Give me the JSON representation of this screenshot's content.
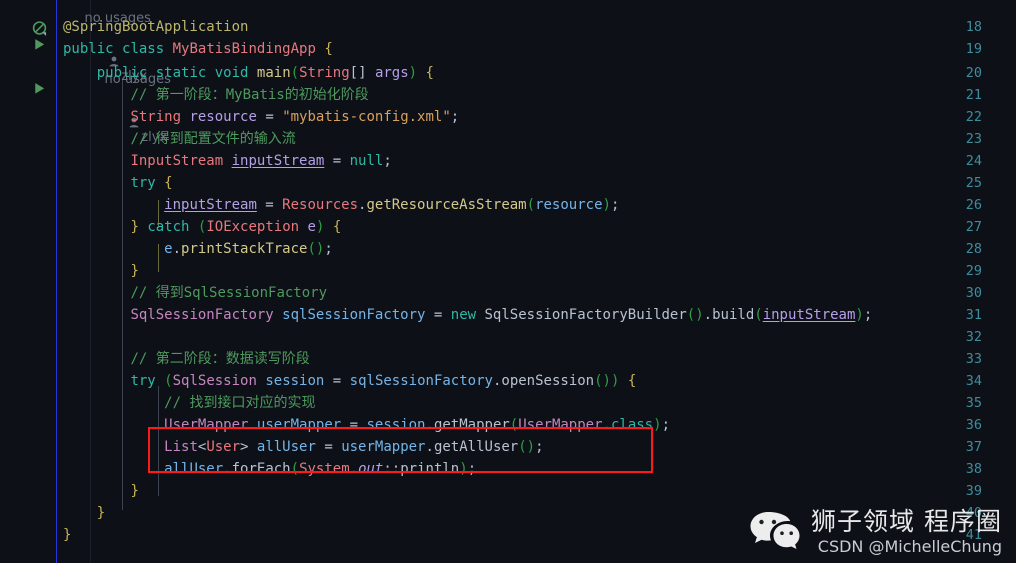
{
  "editor": {
    "background": "#0d1017",
    "gutter_marker_color": "#2736d8",
    "line_number_color": "#3f8d9b",
    "top_partial_hint": {
      "text": "no usages",
      "author": "zlyx",
      "person_icon": "person-icon"
    },
    "inlay_hint": {
      "text": "no usages",
      "author": "zlyx",
      "person_icon": "person-icon"
    },
    "gutter_icons": [
      {
        "line": 18,
        "icon": "spring-bean-icon",
        "color": "#4e9a5e"
      },
      {
        "line": 19,
        "icon": "run-icon",
        "color": "#4e9a5e"
      },
      {
        "line": 20,
        "icon": "run-icon",
        "color": "#4e9a5e"
      }
    ],
    "highlight_box": {
      "color": "#ff1a1a",
      "lines": [
        36,
        37
      ]
    },
    "line_numbers": [
      18,
      19,
      20,
      21,
      22,
      23,
      24,
      25,
      26,
      27,
      28,
      29,
      30,
      31,
      32,
      33,
      34,
      35,
      36,
      37,
      38,
      39,
      40,
      41
    ],
    "lines": {
      "18": "@SpringBootApplication",
      "19": "public class MyBatisBindingApp {",
      "20": "    public static void main(String[] args) {",
      "21": "        // 第一阶段：MyBatis的初始化阶段",
      "22": "        String resource = \"mybatis-config.xml\";",
      "23": "        // 得到配置文件的输入流",
      "24": "        InputStream inputStream = null;",
      "25": "        try {",
      "26": "            inputStream = Resources.getResourceAsStream(resource);",
      "27": "        } catch (IOException e) {",
      "28": "            e.printStackTrace();",
      "29": "        }",
      "30": "        // 得到SqlSessionFactory",
      "31": "        SqlSessionFactory sqlSessionFactory = new SqlSessionFactoryBuilder().build(inputStream);",
      "32": "",
      "33": "        // 第二阶段：数据读写阶段",
      "34": "        try (SqlSession session = sqlSessionFactory.openSession()) {",
      "35": "            // 找到接口对应的实现",
      "36": "            UserMapper userMapper = session.getMapper(UserMapper.class);",
      "37": "            List<User> allUser = userMapper.getAllUser();",
      "38": "            allUser.forEach(System.out::println);",
      "39": "        }",
      "40": "    }",
      "41": "}"
    },
    "tokens": {
      "l18": [
        [
          "@SpringBootApplication",
          "anno"
        ]
      ],
      "l19": [
        [
          "public",
          "kw"
        ],
        [
          " ",
          "punc"
        ],
        [
          "class",
          "kw"
        ],
        [
          " ",
          "punc"
        ],
        [
          "MyBatisBindingApp",
          "cls"
        ],
        [
          " ",
          "punc"
        ],
        [
          "{",
          "brace"
        ]
      ],
      "l20": [
        [
          "    ",
          "punc"
        ],
        [
          "public",
          "kw"
        ],
        [
          " ",
          "punc"
        ],
        [
          "static",
          "kw"
        ],
        [
          " ",
          "punc"
        ],
        [
          "void",
          "kw"
        ],
        [
          " ",
          "punc"
        ],
        [
          "main",
          "mth"
        ],
        [
          "(",
          "paren"
        ],
        [
          "String",
          "cls"
        ],
        [
          "[] ",
          "punc"
        ],
        [
          "args",
          "field"
        ],
        [
          ")",
          "paren"
        ],
        [
          " ",
          "punc"
        ],
        [
          "{",
          "brace"
        ]
      ],
      "l21": [
        [
          "        ",
          "punc"
        ],
        [
          "// 第一阶段：MyBatis的初始化阶段",
          "cmt"
        ]
      ],
      "l22": [
        [
          "        ",
          "punc"
        ],
        [
          "String",
          "cls"
        ],
        [
          " ",
          "punc"
        ],
        [
          "resource",
          "field"
        ],
        [
          " = ",
          "punc"
        ],
        [
          "\"mybatis-config.xml\"",
          "str"
        ],
        [
          ";",
          "punc"
        ]
      ],
      "l23": [
        [
          "        ",
          "punc"
        ],
        [
          "// 得到配置文件的输入流",
          "cmt"
        ]
      ],
      "l24": [
        [
          "        ",
          "punc"
        ],
        [
          "InputStream",
          "cls"
        ],
        [
          " ",
          "punc"
        ],
        [
          "inputStream",
          "fieldu"
        ],
        [
          " = ",
          "punc"
        ],
        [
          "null",
          "kw"
        ],
        [
          ";",
          "punc"
        ]
      ],
      "l25": [
        [
          "        ",
          "punc"
        ],
        [
          "try",
          "kw"
        ],
        [
          " ",
          "punc"
        ],
        [
          "{",
          "brace"
        ]
      ],
      "l26": [
        [
          "            ",
          "punc"
        ],
        [
          "inputStream",
          "fieldu"
        ],
        [
          " = ",
          "punc"
        ],
        [
          "Resources",
          "cls"
        ],
        [
          ".",
          "punc"
        ],
        [
          "getResourceAsStream",
          "mth"
        ],
        [
          "(",
          "paren"
        ],
        [
          "resource",
          "lvar"
        ],
        [
          ")",
          "paren"
        ],
        [
          ";",
          "punc"
        ]
      ],
      "l27": [
        [
          "        ",
          "punc"
        ],
        [
          "}",
          "brace"
        ],
        [
          " ",
          "punc"
        ],
        [
          "catch",
          "kw"
        ],
        [
          " ",
          "punc"
        ],
        [
          "(",
          "paren"
        ],
        [
          "IOException",
          "cls"
        ],
        [
          " ",
          "punc"
        ],
        [
          "e",
          "field"
        ],
        [
          ")",
          "paren"
        ],
        [
          " ",
          "punc"
        ],
        [
          "{",
          "brace"
        ]
      ],
      "l28": [
        [
          "            ",
          "punc"
        ],
        [
          "e",
          "lvar"
        ],
        [
          ".",
          "punc"
        ],
        [
          "printStackTrace",
          "mth"
        ],
        [
          "(",
          "paren"
        ],
        [
          ")",
          "paren"
        ],
        [
          ";",
          "punc"
        ]
      ],
      "l29": [
        [
          "        ",
          "punc"
        ],
        [
          "}",
          "brace"
        ]
      ],
      "l30": [
        [
          "        ",
          "punc"
        ],
        [
          "// 得到SqlSessionFactory",
          "cmt"
        ]
      ],
      "l31": [
        [
          "        ",
          "punc"
        ],
        [
          "SqlSessionFactory",
          "iface"
        ],
        [
          " ",
          "punc"
        ],
        [
          "sqlSessionFactory",
          "lvar"
        ],
        [
          " = ",
          "punc"
        ],
        [
          "new",
          "kw"
        ],
        [
          " ",
          "punc"
        ],
        [
          "SqlSessionFactoryBuilder",
          "punc"
        ],
        [
          "(",
          "paren"
        ],
        [
          ")",
          "paren"
        ],
        [
          ".",
          "punc"
        ],
        [
          "build",
          "punc"
        ],
        [
          "(",
          "paren"
        ],
        [
          "inputStream",
          "fieldu"
        ],
        [
          ")",
          "paren"
        ],
        [
          ";",
          "punc"
        ]
      ],
      "l32": [],
      "l33": [
        [
          "        ",
          "punc"
        ],
        [
          "// 第二阶段：数据读写阶段",
          "cmt"
        ]
      ],
      "l34": [
        [
          "        ",
          "punc"
        ],
        [
          "try",
          "kw"
        ],
        [
          " ",
          "punc"
        ],
        [
          "(",
          "paren"
        ],
        [
          "SqlSession",
          "iface"
        ],
        [
          " ",
          "punc"
        ],
        [
          "session",
          "lvar"
        ],
        [
          " = ",
          "punc"
        ],
        [
          "sqlSessionFactory",
          "lvar"
        ],
        [
          ".",
          "punc"
        ],
        [
          "openSession",
          "punc"
        ],
        [
          "(",
          "paren"
        ],
        [
          ")",
          "paren"
        ],
        [
          ")",
          "paren"
        ],
        [
          " ",
          "punc"
        ],
        [
          "{",
          "brace"
        ]
      ],
      "l35": [
        [
          "            ",
          "punc"
        ],
        [
          "// 找到接口对应的实现",
          "cmt"
        ]
      ],
      "l36": [
        [
          "            ",
          "punc"
        ],
        [
          "UserMapper",
          "iface"
        ],
        [
          " ",
          "punc"
        ],
        [
          "userMapper",
          "lvar"
        ],
        [
          " = ",
          "punc"
        ],
        [
          "session",
          "lvar"
        ],
        [
          ".",
          "punc"
        ],
        [
          "getMapper",
          "punc"
        ],
        [
          "(",
          "paren"
        ],
        [
          "UserMapper",
          "iface"
        ],
        [
          ".",
          "punc"
        ],
        [
          "class",
          "kw"
        ],
        [
          ")",
          "paren"
        ],
        [
          ";",
          "punc"
        ]
      ],
      "l37": [
        [
          "            ",
          "punc"
        ],
        [
          "List",
          "iface"
        ],
        [
          "<",
          "angle"
        ],
        [
          "User",
          "cls"
        ],
        [
          "> ",
          "angle"
        ],
        [
          "allUser",
          "lvar"
        ],
        [
          " = ",
          "punc"
        ],
        [
          "userMapper",
          "lvar"
        ],
        [
          ".",
          "punc"
        ],
        [
          "getAllUser",
          "punc"
        ],
        [
          "(",
          "paren"
        ],
        [
          ")",
          "paren"
        ],
        [
          ";",
          "punc"
        ]
      ],
      "l38": [
        [
          "            ",
          "punc"
        ],
        [
          "allUser",
          "lvar"
        ],
        [
          ".",
          "punc"
        ],
        [
          "forEach",
          "punc"
        ],
        [
          "(",
          "paren"
        ],
        [
          "System",
          "cls"
        ],
        [
          ".",
          "punc"
        ],
        [
          "out",
          "stat"
        ],
        [
          "::",
          "punc"
        ],
        [
          "println",
          "punc"
        ],
        [
          ")",
          "paren"
        ],
        [
          ";",
          "punc"
        ]
      ],
      "l39": [
        [
          "        ",
          "punc"
        ],
        [
          "}",
          "brace"
        ]
      ],
      "l40": [
        [
          "    ",
          "punc"
        ],
        [
          "}",
          "brace"
        ]
      ],
      "l41": [
        [
          "}",
          "brace"
        ]
      ]
    }
  },
  "watermark": {
    "logo_icon": "wechat-icon",
    "title": "狮子领域 程序圈",
    "subtitle": "CSDN @MichelleChung"
  }
}
